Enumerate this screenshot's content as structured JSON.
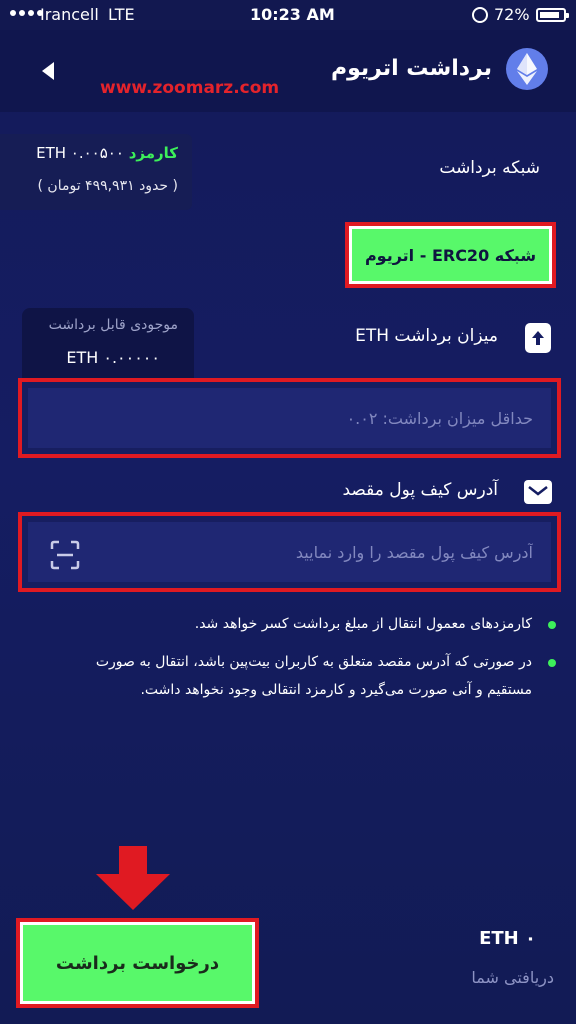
{
  "status_bar": {
    "carrier": "Irancell",
    "network": "LTE",
    "time": "10:23 AM",
    "battery": "72%"
  },
  "header": {
    "title": "برداشت اتریوم",
    "logo_icon": "ethereum-logo-icon",
    "back_icon": "back-arrow-icon"
  },
  "watermark": "www.zoomarz.com",
  "fee": {
    "label": "کارمزد",
    "value": "۰.۰۰۵۰۰ ETH",
    "approx": "( حدود ۴۹۹,۹۳۱ تومان )"
  },
  "network": {
    "label": "شبکه برداشت",
    "selected": "شبکه  ERC20 - اتریوم"
  },
  "balance": {
    "label": "موجودی قابل برداشت",
    "value": "ETH ۰.۰۰۰۰۰"
  },
  "amount": {
    "label": "میزان برداشت ETH",
    "icon": "upload-icon",
    "placeholder": "حداقل میزان برداشت: ۰.۰۲"
  },
  "address": {
    "label": "آدرس کیف پول مقصد",
    "icon": "mail-icon",
    "placeholder": "آدرس کیف پول مقصد را وارد نمایید",
    "scan_icon": "qr-scan-icon"
  },
  "notes": [
    "کارمزدهای معمول انتقال از مبلغ برداشت کسر خواهد شد.",
    "در صورتی که آدرس مقصد متعلق به کاربران بیت‌پین باشد، انتقال به صورت",
    "مستقیم و آنی صورت می‌گیرد و کارمزد انتقالی وجود نخواهد داشت."
  ],
  "receive": {
    "value": "۰ ETH",
    "label": "دریافتی شما"
  },
  "submit": {
    "label": "درخواست برداشت"
  },
  "colors": {
    "background": "#151d62",
    "accent_green": "#58f86a",
    "highlight_red": "#e01a22",
    "eth_blue": "#627eea"
  }
}
